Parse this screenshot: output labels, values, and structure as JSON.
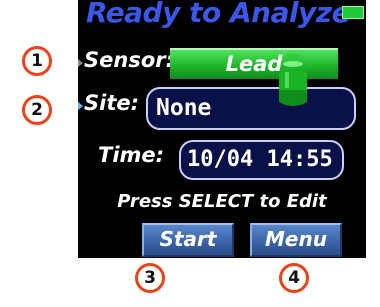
{
  "screen": {
    "title": "Ready to Analyze",
    "battery_color": "#22c93a",
    "sensor": {
      "label": "Sensor:",
      "value": "Lead"
    },
    "site": {
      "label": "Site:",
      "value": "None"
    },
    "time": {
      "label": "Time:",
      "value": "10/04 14:55"
    },
    "prompt": "Press SELECT to Edit",
    "softkeys": {
      "start": "Start",
      "menu": "Menu"
    }
  },
  "callouts": [
    "1",
    "2",
    "3",
    "4"
  ],
  "colors": {
    "title": "#3b57e8",
    "sensor_value_bg": "#1fb52c",
    "field_bg": "#0a1148",
    "softkey_bg": "#3a62a8",
    "callout_ring": "#e8431a",
    "active_cursor": "#5ab8ff"
  },
  "icons": [
    "battery-icon",
    "cursor-arrow-icon",
    "sensor-module-icon"
  ]
}
